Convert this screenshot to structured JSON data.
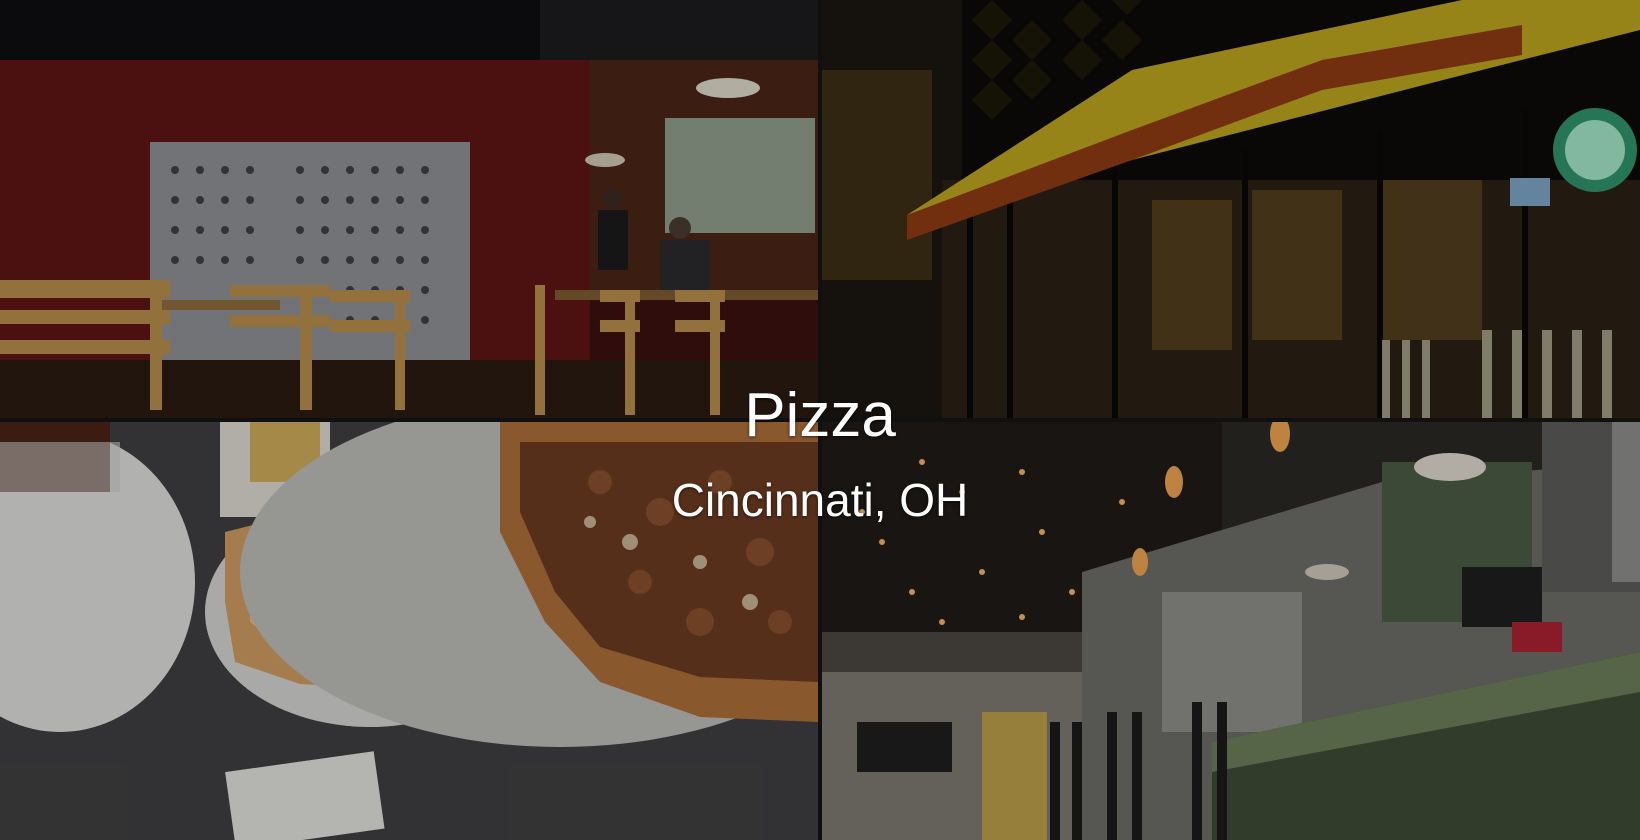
{
  "hero": {
    "title": "Pizza",
    "subtitle": "Cincinnati, OH"
  },
  "tiles": [
    {
      "name": "dining-room-photo"
    },
    {
      "name": "storefront-night-photo"
    },
    {
      "name": "pizza-and-calzone-photo"
    },
    {
      "name": "bar-counter-photo"
    }
  ]
}
